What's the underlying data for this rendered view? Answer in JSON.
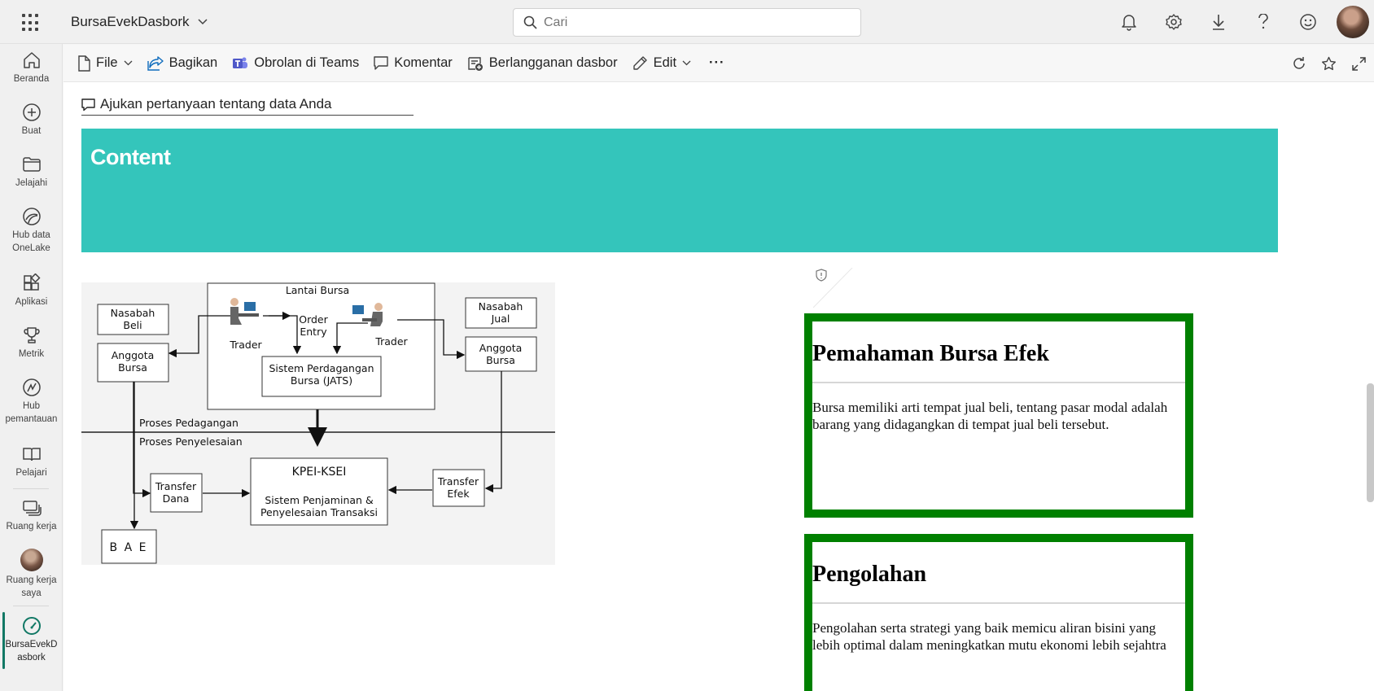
{
  "header": {
    "app_title": "BursaEvekDasbork",
    "search_placeholder": "Cari"
  },
  "nav": {
    "items": [
      {
        "label": "Beranda"
      },
      {
        "label": "Buat"
      },
      {
        "label": "Jelajahi"
      },
      {
        "label": "Hub data OneLake"
      },
      {
        "label": "Aplikasi"
      },
      {
        "label": "Metrik"
      },
      {
        "label": "Hub pemantauan"
      },
      {
        "label": "Pelajari"
      },
      {
        "label": "Ruang kerja"
      },
      {
        "label": "Ruang kerja saya"
      },
      {
        "label": "BursaEvekD asbork"
      }
    ]
  },
  "toolbar": {
    "file": "File",
    "share": "Bagikan",
    "teams": "Obrolan di Teams",
    "comment": "Komentar",
    "subscribe": "Berlangganan dasbor",
    "edit": "Edit",
    "more": "···"
  },
  "qna": {
    "placeholder": "Ajukan pertanyaan tentang data Anda"
  },
  "banner": {
    "title": "Content",
    "color": "#34c5bb"
  },
  "diagram": {
    "lantai_bursa": "Lantai Bursa",
    "nasabah_beli": [
      "Nasabah",
      "Beli"
    ],
    "anggota_bursa_left": [
      "Anggota",
      "Bursa"
    ],
    "trader_left": "Trader",
    "order_entry": [
      "Order",
      "Entry"
    ],
    "trader_right": "Trader",
    "nasabah_jual": [
      "Nasabah",
      "Jual"
    ],
    "anggota_bursa_right": [
      "Anggota",
      "Bursa"
    ],
    "jats": [
      "Sistem Perdagangan",
      "Bursa (JATS)"
    ],
    "proses_pedagangan": "Proses Pedagangan",
    "proses_penyelesaian": "Proses Penyelesaian",
    "transfer_dana": [
      "Transfer",
      "Dana"
    ],
    "kpei_title": "KPEI-KSEI",
    "kpei_sub": [
      "Sistem Penjaminan &",
      "Penyelesaian Transaksi"
    ],
    "transfer_efek": [
      "Transfer",
      "Efek"
    ],
    "bae": "B A E"
  },
  "cards": [
    {
      "title": "Pemahaman Bursa Efek",
      "body": "Bursa memiliki arti tempat jual beli, tentang pasar modal adalah barang yang didagangkan di tempat jual beli tersebut."
    },
    {
      "title": "Pengolahan",
      "body": "Pengolahan serta strategi yang baik memicu aliran bisini yang lebih optimal dalam meningkatkan mutu ekonomi lebih sejahtra"
    }
  ],
  "colors": {
    "accent": "#117865",
    "card_border": "#008000"
  }
}
